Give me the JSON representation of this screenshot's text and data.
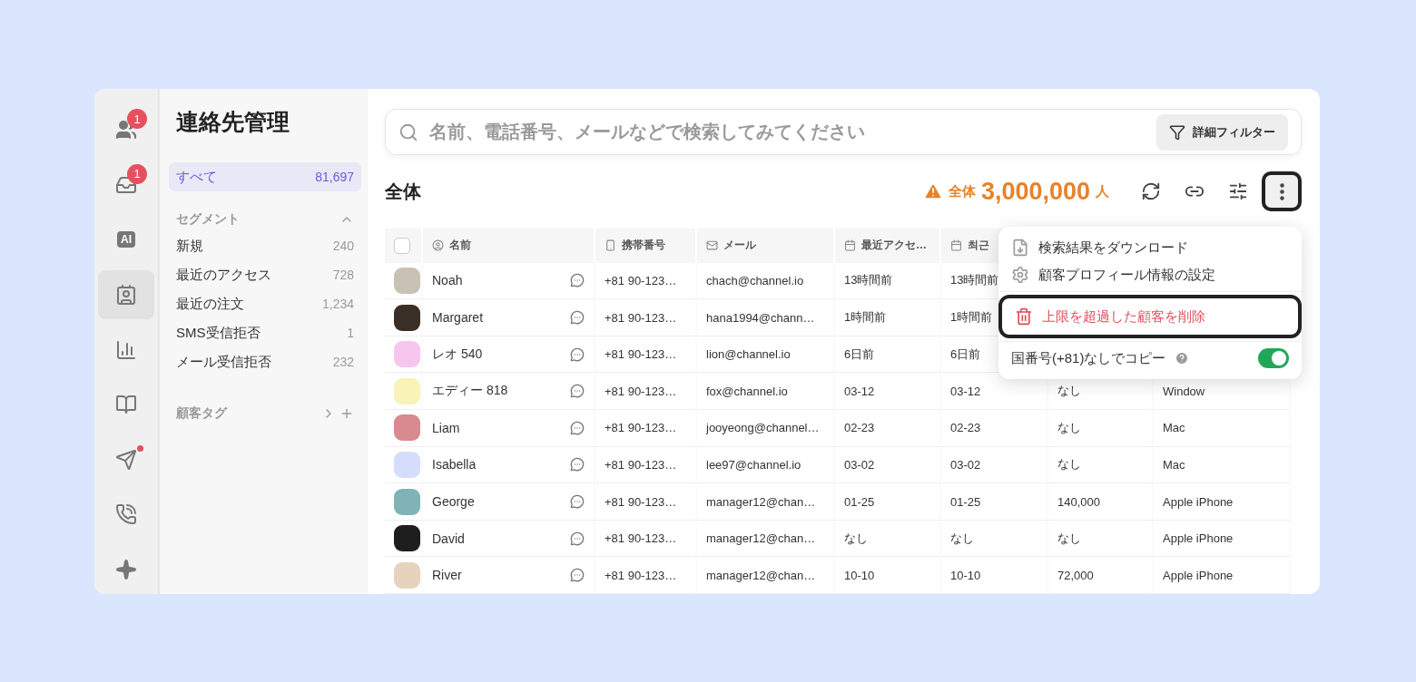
{
  "rail": [
    {
      "badge": "1",
      "dot": false,
      "selected": false
    },
    {
      "badge": "1",
      "dot": false,
      "selected": false
    },
    {
      "label": "AI",
      "dot": false,
      "selected": false
    },
    {
      "dot": false,
      "selected": true
    },
    {
      "dot": false,
      "selected": false
    },
    {
      "dot": false,
      "selected": false
    },
    {
      "dot": true,
      "selected": false
    },
    {
      "dot": false,
      "selected": false
    },
    {
      "dot": false,
      "selected": false
    }
  ],
  "sidebar": {
    "title": "連絡先管理",
    "all": {
      "label": "すべて",
      "count": "81,697",
      "selected": true
    },
    "segment_header": "セグメント",
    "segment_expanded": true,
    "segments": [
      {
        "label": "新規",
        "count": "240",
        "selected": false
      },
      {
        "label": "最近のアクセス",
        "count": "728",
        "selected": false
      },
      {
        "label": "最近の注文",
        "count": "1,234",
        "selected": false
      },
      {
        "label": "SMS受信拒否",
        "count": "1",
        "selected": false
      },
      {
        "label": "メール受信拒否",
        "count": "232",
        "selected": false
      }
    ],
    "tags_header": "顧客タグ"
  },
  "search": {
    "placeholder": "名前、電話番号、メールなどで検索してみてください",
    "filter_button": "詳細フィルター"
  },
  "heading": "全体",
  "total": {
    "label": "全体",
    "value": "3,000,000",
    "unit": "人"
  },
  "toolbar": [
    {
      "highlighted": false
    },
    {
      "highlighted": false
    },
    {
      "highlighted": false
    },
    {
      "highlighted": true
    }
  ],
  "table": {
    "select_all": {
      "checked": false
    },
    "columns": [
      "名前",
      "携帯番号",
      "メール",
      "最近アクセ…",
      "최근"
    ],
    "rows": [
      {
        "name": "Noah",
        "color": "#c9c2b4",
        "phone": "+81 90-123…",
        "email": "chach@channel.io",
        "column_5": "13時間前",
        "column_6": "13時間前"
      },
      {
        "name": "Margaret",
        "color": "#3a2f26",
        "phone": "+81 90-123…",
        "email": "hana1994@chann…",
        "column_5": "1時間前",
        "column_6": "1時間前"
      },
      {
        "name": "レオ 540",
        "color": "#f7c6ef",
        "phone": "+81 90-123…",
        "email": "lion@channel.io",
        "column_5": "6日前",
        "column_6": "6日前"
      },
      {
        "name": "エディー 818",
        "color": "#f8f3b6",
        "phone": "+81 90-123…",
        "email": "fox@channel.io",
        "column_5": "03-12",
        "column_6": "03-12",
        "column_7": "なし",
        "column_8": "Window"
      },
      {
        "name": "Liam",
        "color": "#d98a8f",
        "phone": "+81 90-123…",
        "email": "jooyeong@channel…",
        "column_5": "02-23",
        "column_6": "02-23",
        "column_7": "なし",
        "column_8": "Mac"
      },
      {
        "name": "Isabella",
        "color": "#d6dcfb",
        "phone": "+81 90-123…",
        "email": "lee97@channel.io",
        "column_5": "03-02",
        "column_6": "03-02",
        "column_7": "なし",
        "column_8": "Mac"
      },
      {
        "name": "George",
        "color": "#7fb3b5",
        "phone": "+81 90-123…",
        "email": "manager12@chan…",
        "column_5": "01-25",
        "column_6": "01-25",
        "column_7": "140,000",
        "column_8": "Apple iPhone"
      },
      {
        "name": "David",
        "color": "#1e1e1e",
        "phone": "+81 90-123…",
        "email": "manager12@chan…",
        "column_5": "なし",
        "column_6": "なし",
        "column_7": "なし",
        "column_8": "Apple iPhone"
      },
      {
        "name": "River",
        "color": "#e7d3bd",
        "phone": "+81 90-123…",
        "email": "manager12@chan…",
        "column_5": "10-10",
        "column_6": "10-10",
        "column_7": "72,000",
        "column_8": "Apple iPhone"
      }
    ]
  },
  "menu": {
    "items": [
      {
        "kind": "download",
        "label": "検索結果をダウンロード",
        "highlighted": false
      },
      {
        "kind": "settings",
        "label": "顧客プロフィール情報の設定",
        "highlighted": false
      },
      {
        "kind": "delete",
        "label": "上限を超過した顧客を削除",
        "highlighted": true
      },
      {
        "kind": "toggle",
        "label": "国番号(+81)なしでコピー",
        "on": true,
        "highlighted": false
      }
    ]
  }
}
